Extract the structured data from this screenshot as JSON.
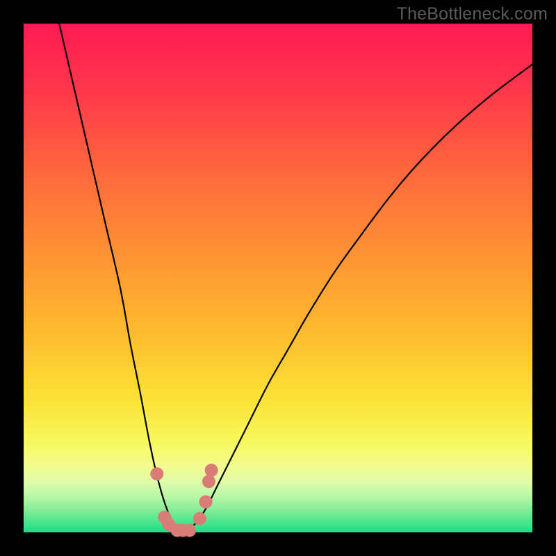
{
  "watermark": "TheBottleneck.com",
  "colors": {
    "frame": "#000000",
    "curve": "#000000",
    "marker_fill": "#da7d76",
    "marker_stroke": "#c56a63",
    "gradient_stops": [
      {
        "offset": "0%",
        "color": "#ff1a53"
      },
      {
        "offset": "14%",
        "color": "#ff3a4a"
      },
      {
        "offset": "30%",
        "color": "#ff6a3c"
      },
      {
        "offset": "48%",
        "color": "#ff9a33"
      },
      {
        "offset": "62%",
        "color": "#fdbf2f"
      },
      {
        "offset": "74%",
        "color": "#fce335"
      },
      {
        "offset": "82%",
        "color": "#f8f85d"
      },
      {
        "offset": "87%",
        "color": "#f1fd8f"
      },
      {
        "offset": "90%",
        "color": "#e0fca8"
      },
      {
        "offset": "93%",
        "color": "#b7f6a8"
      },
      {
        "offset": "96%",
        "color": "#7ceb94"
      },
      {
        "offset": "100%",
        "color": "#18df87"
      }
    ]
  },
  "chart_data": {
    "type": "line",
    "title": "",
    "xlabel": "",
    "ylabel": "",
    "xlim": [
      0,
      100
    ],
    "ylim": [
      0,
      100
    ],
    "x": [
      7,
      10,
      13,
      16,
      19,
      21,
      23,
      24.5,
      26,
      27.5,
      29,
      30,
      31,
      32,
      34,
      36,
      38,
      41,
      44,
      48,
      52,
      56,
      61,
      66,
      72,
      78,
      85,
      92,
      100
    ],
    "values": [
      100,
      87,
      74,
      61,
      48,
      37,
      27,
      19,
      12,
      6.5,
      2.5,
      0.7,
      0,
      0.3,
      2,
      5,
      9,
      15,
      21,
      29,
      36,
      43,
      51,
      58,
      66,
      73,
      80,
      86,
      92
    ],
    "markers": [
      {
        "x": 26.2,
        "y": 11.5
      },
      {
        "x": 27.7,
        "y": 3.0
      },
      {
        "x": 28.5,
        "y": 1.6
      },
      {
        "x": 30.2,
        "y": 0.4
      },
      {
        "x": 31.3,
        "y": 0.4
      },
      {
        "x": 32.6,
        "y": 0.4
      },
      {
        "x": 34.6,
        "y": 2.7
      },
      {
        "x": 35.8,
        "y": 6.0
      },
      {
        "x": 36.4,
        "y": 10.0
      },
      {
        "x": 36.9,
        "y": 12.2
      }
    ]
  }
}
